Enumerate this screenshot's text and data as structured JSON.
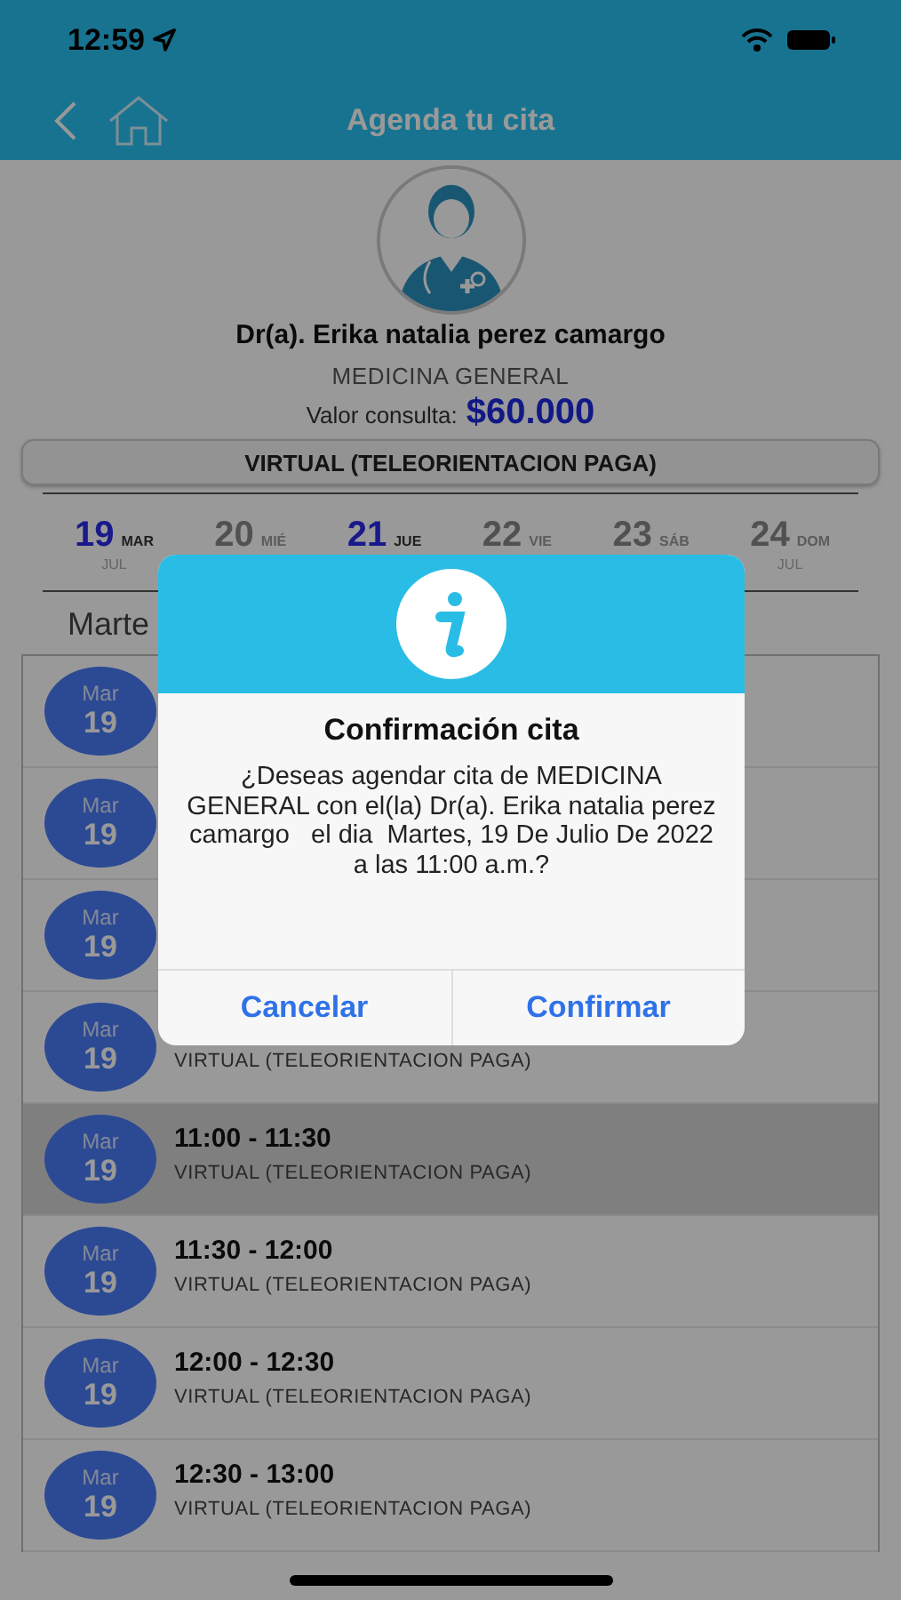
{
  "status_bar": {
    "time": "12:59"
  },
  "nav": {
    "title": "Agenda tu cita"
  },
  "doctor": {
    "name": "Dr(a). Erika natalia perez camargo",
    "specialty": "MEDICINA GENERAL",
    "price_label": "Valor consulta:",
    "price": "$60.000"
  },
  "modality": "VIRTUAL (TELEORIENTACION PAGA)",
  "days": [
    {
      "day": "19",
      "weekday": "MAR",
      "month": "JUL",
      "highlighted": true
    },
    {
      "day": "20",
      "weekday": "MIÉ",
      "highlighted": false
    },
    {
      "day": "21",
      "weekday": "JUE",
      "highlighted": true
    },
    {
      "day": "22",
      "weekday": "VIE",
      "highlighted": false
    },
    {
      "day": "23",
      "weekday": "SÁB",
      "highlighted": false
    },
    {
      "day": "24",
      "weekday": "DOM",
      "month": "JUL",
      "highlighted": false
    }
  ],
  "day_heading": "Marte",
  "slots": [
    {
      "month": "Mar",
      "day": "19",
      "selected": false
    },
    {
      "month": "Mar",
      "day": "19",
      "selected": false
    },
    {
      "month": "Mar",
      "day": "19",
      "selected": false
    },
    {
      "month": "Mar",
      "day": "19",
      "subtitle": "VIRTUAL (TELEORIENTACION PAGA)",
      "selected": false
    },
    {
      "month": "Mar",
      "day": "19",
      "time": "11:00 - 11:30",
      "subtitle": "VIRTUAL (TELEORIENTACION PAGA)",
      "selected": true
    },
    {
      "month": "Mar",
      "day": "19",
      "time": "11:30 - 12:00",
      "subtitle": "VIRTUAL (TELEORIENTACION PAGA)",
      "selected": false
    },
    {
      "month": "Mar",
      "day": "19",
      "time": "12:00 - 12:30",
      "subtitle": "VIRTUAL (TELEORIENTACION PAGA)",
      "selected": false
    },
    {
      "month": "Mar",
      "day": "19",
      "time": "12:30 - 13:00",
      "subtitle": "VIRTUAL (TELEORIENTACION PAGA)",
      "selected": false
    }
  ],
  "dialog": {
    "title": "Confirmación cita",
    "message": "¿Deseas agendar cita de MEDICINA GENERAL con el(la) Dr(a). Erika natalia perez camargo   el dia  Martes, 19 De Julio De 2022 a las 11:00 a.m.?",
    "buttons": [
      "Cancelar",
      "Confirmar"
    ]
  }
}
